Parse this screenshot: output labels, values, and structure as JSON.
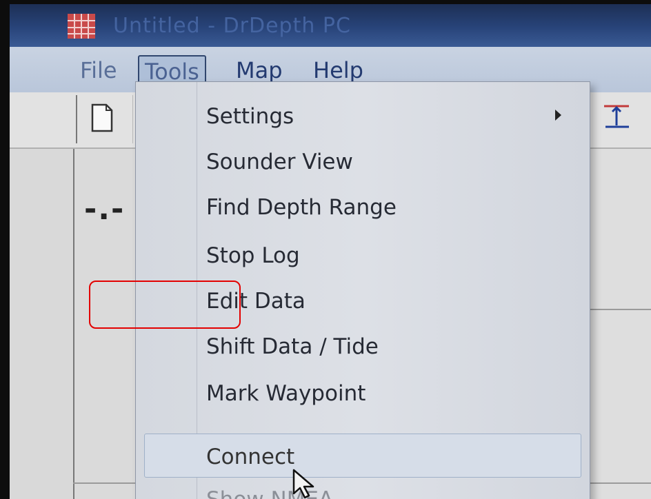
{
  "window": {
    "title": "Untitled - DrDepth PC"
  },
  "menubar": {
    "items": [
      {
        "label": "File"
      },
      {
        "label": "Tools"
      },
      {
        "label": "Map"
      },
      {
        "label": "Help"
      }
    ]
  },
  "toolbar": {
    "buttons": [
      {
        "icon": "new-document-icon"
      },
      {
        "icon": "depth-marker-icon"
      }
    ]
  },
  "main": {
    "depth_readout": "-.-"
  },
  "tools_menu": {
    "items": [
      {
        "label": "Settings",
        "has_submenu": true
      },
      {
        "label": "Sounder View"
      },
      {
        "label": "Find Depth Range"
      },
      {
        "label": "Stop Log"
      },
      {
        "label": "Edit Data",
        "highlighted": true
      },
      {
        "label": "Shift Data / Tide"
      },
      {
        "label": "Mark Waypoint"
      },
      {
        "label": "Connect",
        "hovered": true
      },
      {
        "label": "Show NMEA"
      }
    ]
  },
  "colors": {
    "highlight_box": "#e30000",
    "title_bar": "#28447a",
    "menu_text": "#233a70"
  }
}
